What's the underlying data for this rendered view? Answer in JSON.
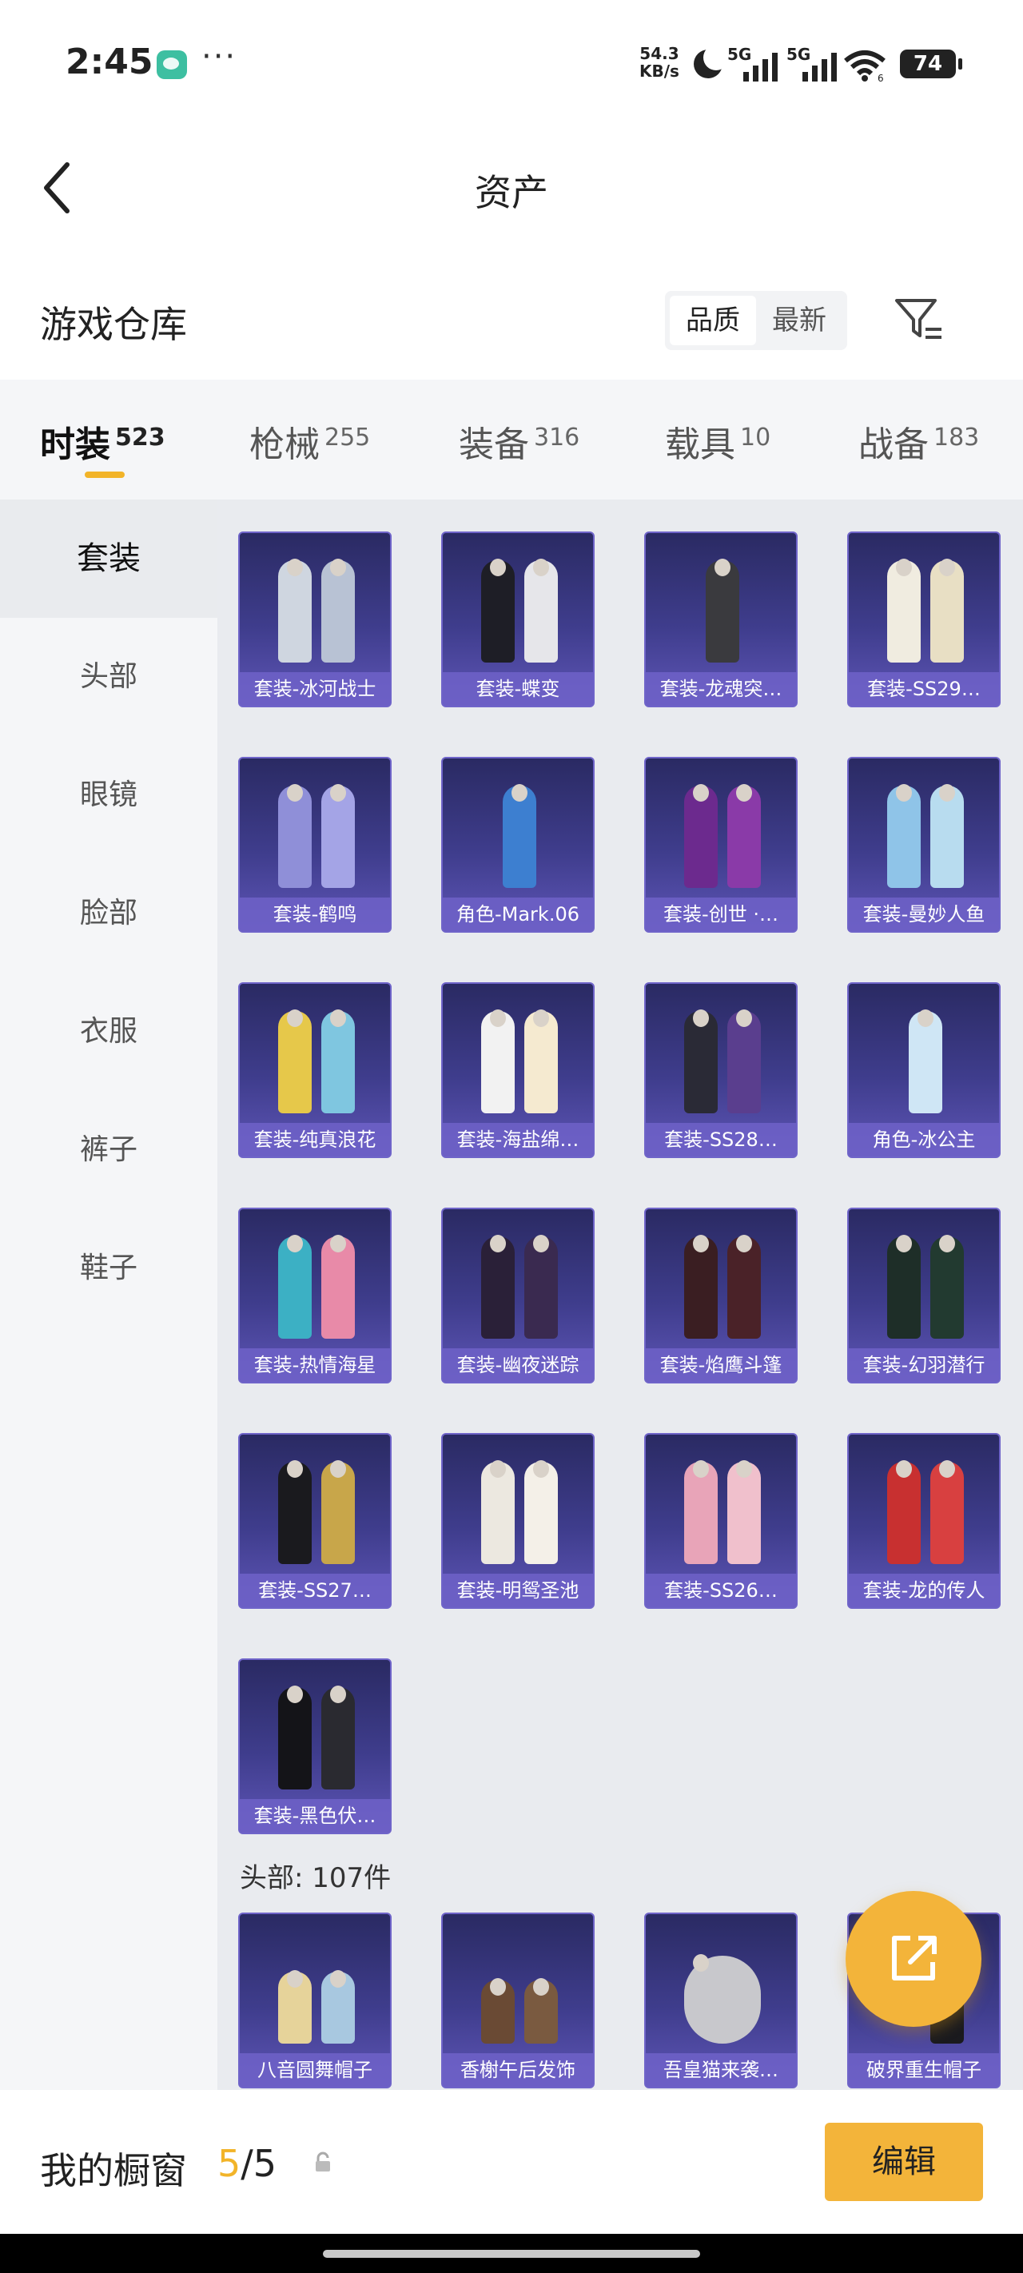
{
  "status_bar": {
    "time": "2:45",
    "net_speed_value": "54.3",
    "net_speed_unit": "KB/s",
    "sim1": "5G",
    "sim2": "5G",
    "wifi_sub": "6",
    "battery": "74"
  },
  "header": {
    "title": "资产"
  },
  "warehouse": {
    "title": "游戏仓库",
    "sort_quality": "品质",
    "sort_latest": "最新"
  },
  "tabs": [
    {
      "label": "时装",
      "count": "523"
    },
    {
      "label": "枪械",
      "count": "255"
    },
    {
      "label": "装备",
      "count": "316"
    },
    {
      "label": "载具",
      "count": "10"
    },
    {
      "label": "战备",
      "count": "183"
    }
  ],
  "sidebar": {
    "items": [
      "套装",
      "头部",
      "眼镜",
      "脸部",
      "衣服",
      "裤子",
      "鞋子"
    ]
  },
  "suits": [
    {
      "name": "套装-冰河战士"
    },
    {
      "name": "套装-蝶变"
    },
    {
      "name": "套装-龙魂突…"
    },
    {
      "name": "套装-SS29…"
    },
    {
      "name": "套装-鹤鸣"
    },
    {
      "name": "角色-Mark.06"
    },
    {
      "name": "套装-创世 ·…"
    },
    {
      "name": "套装-曼妙人鱼"
    },
    {
      "name": "套装-纯真浪花"
    },
    {
      "name": "套装-海盐绵…"
    },
    {
      "name": "套装-SS28…"
    },
    {
      "name": "角色-冰公主"
    },
    {
      "name": "套装-热情海星"
    },
    {
      "name": "套装-幽夜迷踪"
    },
    {
      "name": "套装-焰鹰斗篷"
    },
    {
      "name": "套装-幻羽潜行"
    },
    {
      "name": "套装-SS27…"
    },
    {
      "name": "套装-明鸳圣池"
    },
    {
      "name": "套装-SS26…"
    },
    {
      "name": "套装-龙的传人"
    },
    {
      "name": "套装-黑色伏…"
    }
  ],
  "head_section": {
    "label": "头部: 107件",
    "items": [
      {
        "name": "八音圆舞帽子"
      },
      {
        "name": "香榭午后发饰"
      },
      {
        "name": "吾皇猫来袭…"
      },
      {
        "name": "破界重生帽子"
      }
    ]
  },
  "bottom": {
    "label": "我的橱窗",
    "current": "5",
    "sep_total": "/5",
    "edit": "编辑"
  },
  "colors": {
    "accent": "#f3b43a",
    "card_top": "#2a2a63",
    "card_bottom": "#5e55b6"
  }
}
